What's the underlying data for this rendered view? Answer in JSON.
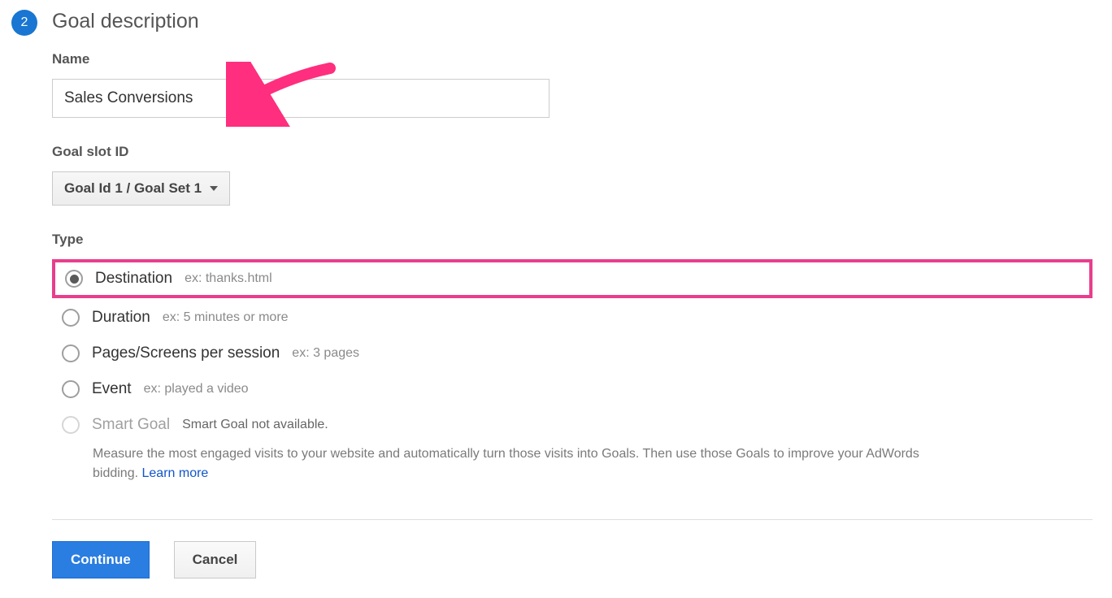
{
  "step": {
    "number": "2"
  },
  "section_title": "Goal description",
  "name": {
    "label": "Name",
    "value": "Sales Conversions"
  },
  "goal_slot": {
    "label": "Goal slot ID",
    "selected": "Goal Id 1 / Goal Set 1"
  },
  "type": {
    "label": "Type",
    "options": [
      {
        "label": "Destination",
        "hint": "ex: thanks.html",
        "selected": true,
        "highlighted": true,
        "disabled": false
      },
      {
        "label": "Duration",
        "hint": "ex: 5 minutes or more",
        "selected": false,
        "highlighted": false,
        "disabled": false
      },
      {
        "label": "Pages/Screens per session",
        "hint": "ex: 3 pages",
        "selected": false,
        "highlighted": false,
        "disabled": false
      },
      {
        "label": "Event",
        "hint": "ex: played a video",
        "selected": false,
        "highlighted": false,
        "disabled": false
      },
      {
        "label": "Smart Goal",
        "hint": "Smart Goal not available.",
        "selected": false,
        "highlighted": false,
        "disabled": true
      }
    ],
    "smart_description": "Measure the most engaged visits to your website and automatically turn those visits into Goals. Then use those Goals to improve your AdWords bidding. ",
    "learn_more": "Learn more"
  },
  "buttons": {
    "continue": "Continue",
    "cancel": "Cancel"
  }
}
